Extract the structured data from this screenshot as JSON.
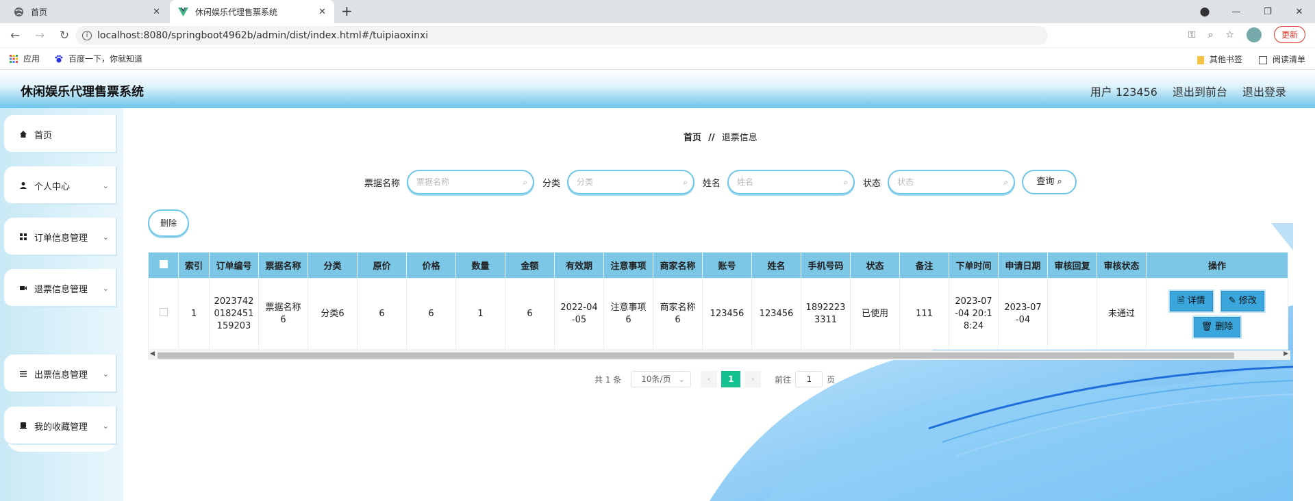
{
  "browser": {
    "tabs": [
      {
        "title": "首页"
      },
      {
        "title": "休闲娱乐代理售票系统"
      }
    ],
    "url": "localhost:8080/springboot4962b/admin/dist/index.html#/tuipiaoxinxi",
    "update_label": "更新",
    "bookmarks": [
      "应用",
      "百度一下，你就知道"
    ],
    "bookmarks_right": [
      "其他书签",
      "阅读清单"
    ]
  },
  "header": {
    "title": "休闲娱乐代理售票系统",
    "user": "用户 123456",
    "to_front": "退出到前台",
    "logout": "退出登录"
  },
  "sidebar": {
    "items": [
      {
        "label": "首页",
        "icon": "home-icon"
      },
      {
        "label": "个人中心",
        "icon": "user-icon"
      },
      {
        "label": "订单信息管理",
        "icon": "grid-icon"
      },
      {
        "label": "退票信息管理",
        "icon": "ticket-icon"
      },
      {
        "label": "出票信息管理",
        "icon": "list-icon"
      },
      {
        "label": "我的收藏管理",
        "icon": "bookmark-icon"
      }
    ],
    "sub_item": "退票信息"
  },
  "breadcrumb": {
    "home": "首页",
    "sep": "//",
    "current": "退票信息"
  },
  "search": {
    "fields": [
      {
        "label": "票据名称",
        "placeholder": "票据名称"
      },
      {
        "label": "分类",
        "placeholder": "分类"
      },
      {
        "label": "姓名",
        "placeholder": "姓名"
      },
      {
        "label": "状态",
        "placeholder": "状态"
      }
    ],
    "query_label": "查询"
  },
  "toolbar": {
    "delete_label": "删除"
  },
  "table": {
    "columns": [
      "索引",
      "订单编号",
      "票据名称",
      "分类",
      "原价",
      "价格",
      "数量",
      "金额",
      "有效期",
      "注意事项",
      "商家名称",
      "账号",
      "姓名",
      "手机号码",
      "状态",
      "备注",
      "下单时间",
      "申请日期",
      "审核回复",
      "审核状态",
      "操作"
    ],
    "rows": [
      {
        "index": "1",
        "order_no": "2023742 0182451 159203",
        "ticket_name": "票据名称 6",
        "category": "分类6",
        "orig_price": "6",
        "price": "6",
        "qty": "1",
        "amount": "6",
        "valid": "2022-04 -05",
        "notes": "注意事项 6",
        "merchant": "商家名称 6",
        "account": "123456",
        "name": "123456",
        "phone": "1892223 3311",
        "status": "已使用",
        "remark": "111",
        "order_time": "2023-07 -04 20:1 8:24",
        "apply_date": "2023-07 -04",
        "review_reply": "",
        "review_status": "未通过"
      }
    ],
    "actions": {
      "detail": "详情",
      "edit": "修改",
      "delete": "删除"
    }
  },
  "pagination": {
    "total": "共 1 条",
    "page_size": "10条/页",
    "current": "1",
    "goto_label": "前往",
    "goto_value": "1",
    "page_suffix": "页"
  }
}
